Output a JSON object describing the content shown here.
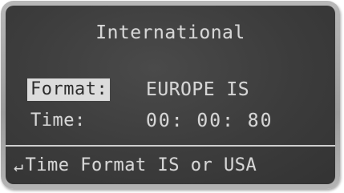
{
  "screen": {
    "title": "International",
    "fields": {
      "format_label": "Format:",
      "format_value": "EUROPE IS",
      "time_label": "Time:",
      "time_value": "00: 00: 80"
    },
    "hint": {
      "icon": "enter-arrow-icon",
      "arrow_glyph": "↵",
      "text": "Time Format IS or USA"
    }
  },
  "colors": {
    "lcd_background": "#3c3c3c",
    "lcd_text": "#d6d6d6",
    "highlight_background": "#dcdcdc",
    "bezel": "#a8a8a8"
  }
}
